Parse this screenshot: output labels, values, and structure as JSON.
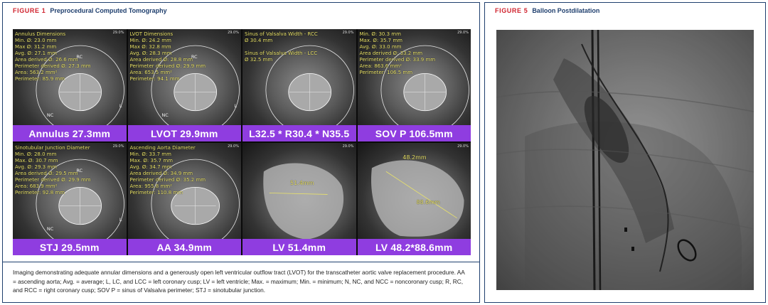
{
  "left_figure": {
    "label": "FIGURE 1",
    "title": "Preprocedural Computed Tomography",
    "panels": [
      {
        "caption": "Annulus  27.3mm",
        "zoom": "29.0%",
        "measurements": [
          "Annulus Dimensions",
          "Min. Ø: 23.0 mm",
          "Max Ø: 31.2 mm",
          "Avg. Ø: 27.1 mm",
          "Area derived Ø: 26.6 mm",
          "Perimeter derived Ø: 27.3 mm",
          "Area: 563.2 mm²",
          "Perimeter: 85.9 mm"
        ],
        "cusps": [
          "RC",
          "L",
          "NC"
        ]
      },
      {
        "caption": "LVOT  29.9mm",
        "zoom": "29.0%",
        "measurements": [
          "LVOT Dimensions",
          "Min. Ø: 24.2 mm",
          "Max Ø: 32.8 mm",
          "Avg. Ø: 28.3 mm",
          "Area derived Ø: 28.8 mm",
          "Perimeter derived Ø: 29.9 mm",
          "Area: 653.5 mm²",
          "Perimeter: 94.1 mm"
        ],
        "cusps": [
          "RC",
          "L",
          "NC"
        ]
      },
      {
        "caption": "L32.5 * R30.4 * N35.5",
        "zoom": "29.0%",
        "measurements": [
          "Sinus of Valsalva Width - RCC",
          "Ø 30.4 mm",
          "",
          "Sinus of Valsalva Width - LCC",
          "Ø 32.5 mm"
        ],
        "cusps": []
      },
      {
        "caption": "SOV P  106.5mm",
        "zoom": "29.0%",
        "measurements": [
          "Min. Ø: 30.3 mm",
          "Max. Ø: 35.7 mm",
          "Avg. Ø: 33.0 mm",
          "Area derived Ø: 33.2 mm",
          "Perimeter derived Ø: 33.9 mm",
          "Area: 863.6 mm²",
          "Perimeter: 106.5 mm"
        ],
        "cusps": []
      },
      {
        "caption": "STJ  29.5mm",
        "zoom": "29.0%",
        "measurements": [
          "Sinotubular Junction Diameter",
          "Min. Ø: 28.0 mm",
          "Max. Ø: 30.7 mm",
          "Avg. Ø: 29.3 mm",
          "Area derived Ø: 29.5 mm",
          "Perimeter derived Ø: 29.9 mm",
          "Area: 683.9 mm²",
          "Perimeter: 92.8 mm"
        ],
        "cusps": [
          "RC",
          "L",
          "NC"
        ]
      },
      {
        "caption": "AA  34.9mm",
        "zoom": "29.0%",
        "measurements": [
          "Ascending Aorta Diameter",
          "Min. Ø: 33.7 mm",
          "Max. Ø: 35.7 mm",
          "Avg. Ø: 34.7 mm",
          "Area derived Ø: 34.9 mm",
          "Perimeter derived Ø: 35.2 mm",
          "Area: 955.8 mm²",
          "Perimeter: 110.8 mm"
        ],
        "cusps": []
      },
      {
        "caption": "LV  51.4mm",
        "zoom": "29.0%",
        "mid_label": "51.4mm",
        "measurements": [],
        "cusps": []
      },
      {
        "caption": "LV  48.2*88.6mm",
        "zoom": "29.0%",
        "mid_label": "88.6mm",
        "top_label": "48.2mm",
        "measurements": [],
        "cusps": []
      }
    ],
    "legend": "Imaging demonstrating adequate annular dimensions and a generously open left ventricular outflow tract (LVOT) for the transcatheter aortic valve replacement procedure. AA = ascending aorta; Avg. = average; L, LC, and LCC = left coronary cusp; LV = left ventricle; Max. = maximum; Min. = minimum; N, NC, and NCC = noncoronary cusp; R, RC, and RCC = right coronary cusp; SOV P = sinus of Valsalva perimeter; STJ = sinotubular junction."
  },
  "right_figure": {
    "label": "FIGURE 5",
    "title": "Balloon Postdilatation"
  },
  "colors": {
    "caption_bar": "#8f3de0",
    "figure_label": "#d0232e",
    "title": "#1f3f6e",
    "measurement_text": "#e9e26a"
  }
}
